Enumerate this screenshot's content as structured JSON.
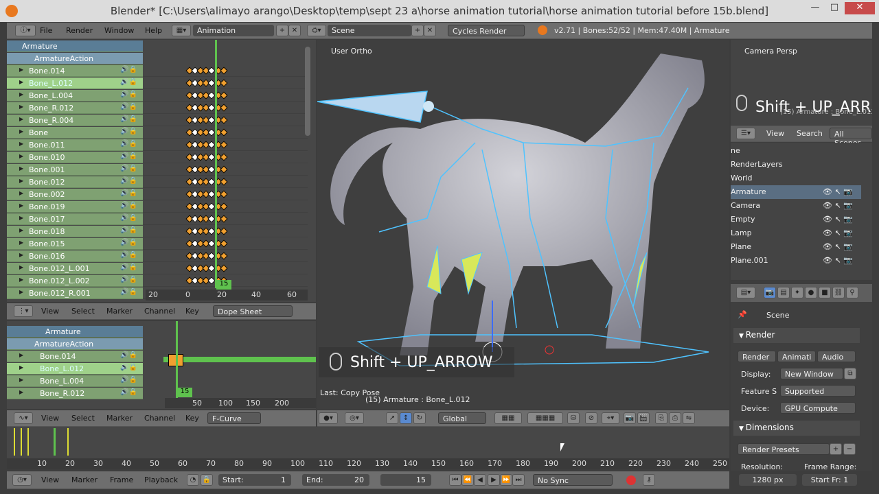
{
  "window": {
    "title": "Blender* [C:\\Users\\alimayo arango\\Desktop\\temp\\sept 23 a\\horse animation tutorial\\horse animation tutorial before 15b.blend]",
    "minimize": "—",
    "maximize": "□",
    "close": "✕"
  },
  "topbar": {
    "menus": [
      "File",
      "Render",
      "Window",
      "Help"
    ],
    "layout": "Animation",
    "scene": "Scene",
    "engine": "Cycles Render",
    "stats": "v2.71 | Bones:52/52 | Mem:47.40M | Armature"
  },
  "dopesheet": {
    "root": "Armature",
    "action": "ArmatureAction",
    "channels": [
      "Bone.014",
      "Bone_L.012",
      "Bone_L.004",
      "Bone_R.012",
      "Bone_R.004",
      "Bone",
      "Bone.011",
      "Bone.010",
      "Bone.001",
      "Bone.012",
      "Bone.002",
      "Bone.019",
      "Bone.017",
      "Bone.018",
      "Bone.015",
      "Bone.016",
      "Bone.012_L.001",
      "Bone.012_L.002",
      "Bone.012_R.001"
    ],
    "ruler": [
      "20",
      "0",
      "20",
      "40",
      "60"
    ],
    "frame": "15",
    "menus": [
      "View",
      "Select",
      "Marker",
      "Channel",
      "Key"
    ],
    "mode": "Dope Sheet"
  },
  "graph": {
    "root": "Armature",
    "action": "ArmatureAction",
    "channels": [
      "Bone.014",
      "Bone_L.012",
      "Bone_L.004",
      "Bone_R.012"
    ],
    "ruler": [
      "50",
      "100",
      "150",
      "200"
    ],
    "frame": "15",
    "menus": [
      "View",
      "Select",
      "Marker",
      "Channel",
      "Key"
    ],
    "mode": "F-Curve"
  },
  "viewport": {
    "label": "User Ortho",
    "overlay": "Shift + UP_ARROW",
    "last_op": "Last: Copy Pose",
    "status": "(15) Armature : Bone_L.012",
    "pivot": "Global"
  },
  "camera_view": {
    "label": "Camera Persp",
    "overlay": "Shift + UP_ARR",
    "status": "(15) Armature : Bone_L.012"
  },
  "outliner": {
    "menus": [
      "View",
      "Search"
    ],
    "filter": "All Scenes",
    "rows": [
      "ne",
      "RenderLayers",
      "World",
      "Armature",
      "Camera",
      "Empty",
      "Lamp",
      "Plane",
      "Plane.001"
    ]
  },
  "properties": {
    "scene": "Scene",
    "render_panel": "Render",
    "buttons": [
      "Render",
      "Animati",
      "Audio"
    ],
    "display_label": "Display:",
    "display": "New Window",
    "feature_label": "Feature S",
    "feature": "Supported",
    "device_label": "Device:",
    "device": "GPU Compute",
    "dimensions_panel": "Dimensions",
    "presets": "Render Presets",
    "resolution_label": "Resolution:",
    "resolution": "1280 px",
    "frame_range_label": "Frame Range:",
    "start_frame": "Start Fr: 1"
  },
  "timeline": {
    "ruler": [
      "10",
      "20",
      "30",
      "40",
      "50",
      "60",
      "70",
      "80",
      "90",
      "100",
      "110",
      "120",
      "130",
      "140",
      "150",
      "160",
      "170",
      "180",
      "190",
      "200",
      "210",
      "220",
      "230",
      "240",
      "250"
    ],
    "menus": [
      "View",
      "Marker",
      "Frame",
      "Playback"
    ],
    "start_label": "Start:",
    "start": "1",
    "end_label": "End:",
    "end": "20",
    "current": "15",
    "sync": "No Sync"
  }
}
